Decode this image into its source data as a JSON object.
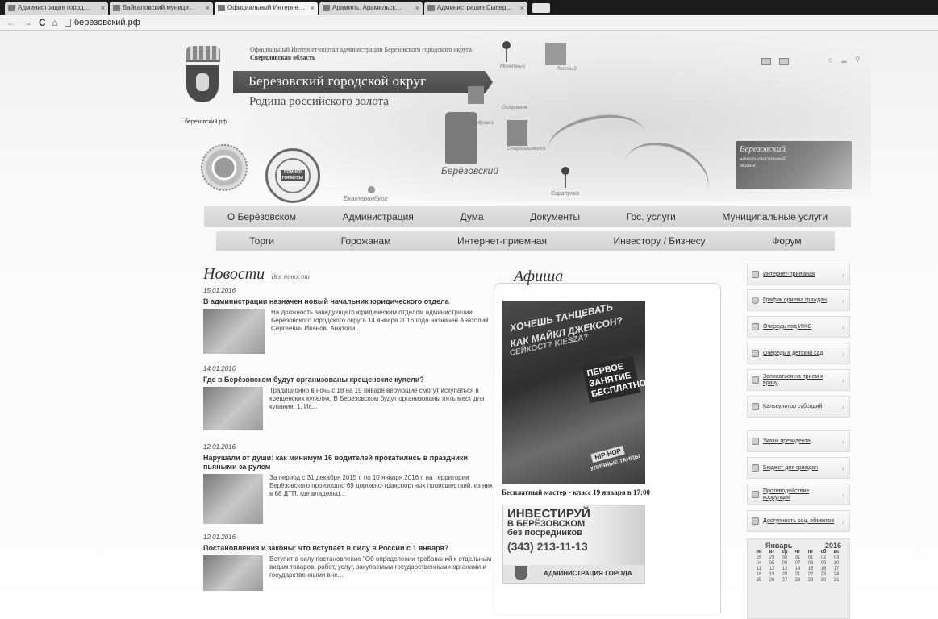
{
  "browser": {
    "tabs": [
      {
        "label": "Администрация город…",
        "active": false
      },
      {
        "label": "Байкаловский муници…",
        "active": false
      },
      {
        "label": "Официальный Интерне…",
        "active": true
      },
      {
        "label": "Арамиль. Арамильск…",
        "active": false
      },
      {
        "label": "Администрация Сысер…",
        "active": false
      }
    ],
    "url": "березовский.рф"
  },
  "header": {
    "portal_line1": "Официальный Интернет-портал администрации Березовского городского округа",
    "portal_line2": "Свердловская область",
    "title": "Березовский городской округ",
    "subtitle": "Родина российского золота",
    "domain_caption": "березовский.рф",
    "seal_text": "ПОМНЮ! ГОРЖУСЬ!"
  },
  "map_labels": {
    "ekaterinburg": "Екатеринбург",
    "berezovsky": "Берёзовский",
    "sarapulka": "Сарапулка",
    "monetny": "Монетный",
    "losiny": "Лосиный",
    "kedrovka": "Кедровка",
    "starypyshminsk": "Старопышминск",
    "ostrovnoy": "Островное"
  },
  "promo_banner": {
    "title": "Березовский",
    "subtitle": "начало счастливой жизни"
  },
  "menu_primary": [
    "О Берёзовском",
    "Администрация",
    "Дума",
    "Документы",
    "Гос. услуги",
    "Муниципальные услуги"
  ],
  "menu_secondary": [
    "Торги",
    "Горожанам",
    "Интернет-приемная",
    "Инвестору / Бизнесу",
    "Форум"
  ],
  "news": {
    "title": "Новости",
    "all_link": "Все новости",
    "items": [
      {
        "date": "15.01.2016",
        "headline": "В администрации назначен новый начальник юридического отдела",
        "text": "На должность заведующего юридическим отделом администрации Берёзовского городского округа 14 января 2016 года назначен Анатолий Сергеевич Иванов. Анатоли..."
      },
      {
        "date": "14.01.2016",
        "headline": "Где в Берёзовском будут организованы крещенские купели?",
        "text": "Традиционно в ночь с 18 на 19 января верующие смогут искупаться в крещенских купелях. В Берёзовском будут организованы пять мест для купания. 1. Ис..."
      },
      {
        "date": "12.01.2016",
        "headline": "Нарушали от души: как минимум 16 водителей прокатились в праздники пьяными за рулем",
        "text": "За период с 31 декабря 2015 г. по 10 января 2016 г. на территории Берёзовского произошло 69 дорожно-транспортных происшествий, из них в 68 ДТП, где владельц..."
      },
      {
        "date": "12.01.2016",
        "headline": "Постановления и законы: что вступает в силу в России с 1 января?",
        "text": "Вступит в силу постановление \"Об определении требований к отдельным видам товаров, работ, услуг, закупаемым государственными органами и государственными вне..."
      }
    ]
  },
  "afisha": {
    "title": "Афиша",
    "poster_line1": "ХОЧЕШЬ ТАНЦЕВАТЬ",
    "poster_line2": "КАК МАЙКЛ ДЖЕКСОН?",
    "poster_line3": "СЕЙКОСТ? KIESZA?",
    "poster_badge": "ПЕРВОЕ ЗАНЯТИЕ БЕСПЛАТНО!",
    "poster_hiphop": "HIP-HOP",
    "poster_dance": "УЛИЧНЫЕ ТАНЦЫ",
    "caption": "Бесплатный мастер - класс 19 января в 17:00",
    "invest_line1": "ИНВЕСТИРУЙ",
    "invest_line2": "В БЕРЁЗОВСКОМ",
    "invest_line3": "без посредников",
    "invest_phone": "(343) 213-11-13",
    "invest_footer": "АДМИНИСТРАЦИЯ ГОРОДА"
  },
  "sidebar": [
    {
      "label": "Интернет-приемная",
      "icon": "building-icon"
    },
    {
      "label": "График приема граждан",
      "icon": "clock-icon"
    },
    {
      "label": "Очередь под ИЖС",
      "icon": "houses-icon"
    },
    {
      "label": "Очередь в детский сад",
      "icon": "children-icon"
    },
    {
      "label": "Записаться на прием к врачу",
      "icon": "medical-cross-icon"
    },
    {
      "label": "Калькулятор субсидий",
      "icon": "calculator-icon"
    },
    {
      "label": "Указы президента",
      "icon": "flag-icon"
    },
    {
      "label": "Бюджет для граждан",
      "icon": "chart-icon"
    },
    {
      "label": "Противодействие коррупции",
      "icon": "shield-icon"
    },
    {
      "label": "Доступность соц. объектов",
      "icon": "accessibility-icon"
    }
  ],
  "calendar": {
    "month": "Январь",
    "year": "2016",
    "dow": [
      "пн",
      "вт",
      "ср",
      "чт",
      "пт",
      "сб",
      "вс"
    ],
    "weeks": [
      [
        "28",
        "29",
        "30",
        "31",
        "01",
        "02",
        "03"
      ],
      [
        "04",
        "05",
        "06",
        "07",
        "08",
        "09",
        "10"
      ],
      [
        "11",
        "12",
        "13",
        "14",
        "15",
        "16",
        "17"
      ],
      [
        "18",
        "19",
        "20",
        "21",
        "22",
        "23",
        "24"
      ],
      [
        "25",
        "26",
        "27",
        "28",
        "29",
        "30",
        "31"
      ]
    ]
  }
}
